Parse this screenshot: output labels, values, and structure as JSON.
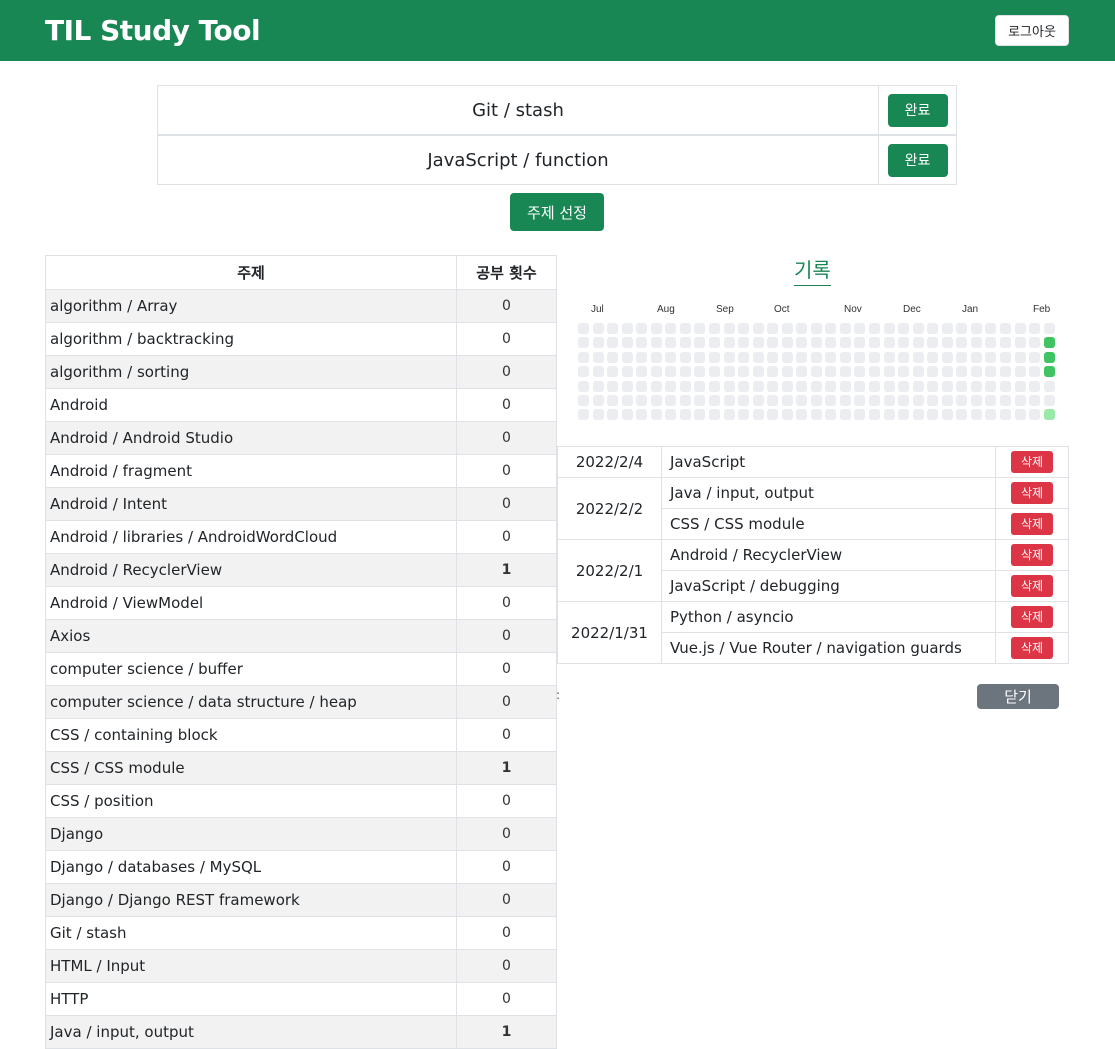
{
  "app": {
    "title": "TIL Study Tool",
    "logout_label": "로그아웃"
  },
  "selected_topics": [
    {
      "topic": "Git / stash",
      "done_label": "완료"
    },
    {
      "topic": "JavaScript / function",
      "done_label": "완료"
    }
  ],
  "pick_button_label": "주제 선정",
  "topic_table": {
    "headers": [
      "주제",
      "공부 횟수"
    ],
    "rows": [
      {
        "topic": "algorithm / Array",
        "count": "0"
      },
      {
        "topic": "algorithm / backtracking",
        "count": "0"
      },
      {
        "topic": "algorithm / sorting",
        "count": "0"
      },
      {
        "topic": "Android",
        "count": "0"
      },
      {
        "topic": "Android / Android Studio",
        "count": "0"
      },
      {
        "topic": "Android / fragment",
        "count": "0"
      },
      {
        "topic": "Android / Intent",
        "count": "0"
      },
      {
        "topic": "Android / libraries / AndroidWordCloud",
        "count": "0"
      },
      {
        "topic": "Android / RecyclerView",
        "count": "1"
      },
      {
        "topic": "Android / ViewModel",
        "count": "0"
      },
      {
        "topic": "Axios",
        "count": "0"
      },
      {
        "topic": "computer science / buffer",
        "count": "0"
      },
      {
        "topic": "computer science / data structure / heap",
        "count": "0"
      },
      {
        "topic": "CSS / containing block",
        "count": "0"
      },
      {
        "topic": "CSS / CSS module",
        "count": "1"
      },
      {
        "topic": "CSS / position",
        "count": "0"
      },
      {
        "topic": "Django",
        "count": "0"
      },
      {
        "topic": "Django / databases / MySQL",
        "count": "0"
      },
      {
        "topic": "Django / Django REST framework",
        "count": "0"
      },
      {
        "topic": "Git / stash",
        "count": "0"
      },
      {
        "topic": "HTML / Input",
        "count": "0"
      },
      {
        "topic": "HTTP",
        "count": "0"
      },
      {
        "topic": "Java / input, output",
        "count": "1"
      }
    ]
  },
  "record": {
    "title": "기록",
    "heatmap": {
      "months": [
        "Jul",
        "Aug",
        "Sep",
        "Oct",
        "Nov",
        "Dec",
        "Jan",
        "Feb"
      ],
      "colors": {
        "empty": "#ebedf0",
        "level1": "#9be9a8",
        "level2": "#40c463"
      }
    },
    "delete_label": "삭제",
    "groups": [
      {
        "date": "2022/2/4",
        "items": [
          "JavaScript"
        ]
      },
      {
        "date": "2022/2/2",
        "items": [
          "Java / input, output",
          "CSS / CSS module"
        ]
      },
      {
        "date": "2022/2/1",
        "items": [
          "Android / RecyclerView",
          "JavaScript / debugging"
        ]
      },
      {
        "date": "2022/1/31",
        "items": [
          "Python / asyncio",
          "Vue.js / Vue Router / navigation guards"
        ]
      }
    ],
    "close_label": "닫기"
  },
  "colors": {
    "brand": "#198754",
    "danger": "#dc3545",
    "secondary": "#6c757d"
  }
}
